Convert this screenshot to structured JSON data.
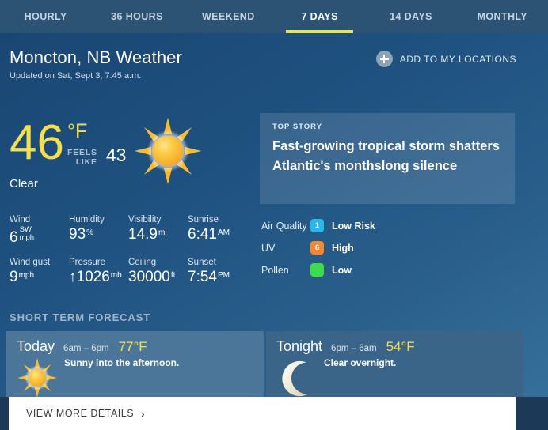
{
  "tabs": [
    {
      "label": "HOURLY",
      "active": false
    },
    {
      "label": "36 HOURS",
      "active": false
    },
    {
      "label": "WEEKEND",
      "active": false
    },
    {
      "label": "7 DAYS",
      "active": true
    },
    {
      "label": "14 DAYS",
      "active": false
    },
    {
      "label": "MONTHLY",
      "active": false
    }
  ],
  "header": {
    "title": "Moncton, NB Weather",
    "updated": "Updated on Sat, Sept 3, 7:45 a.m.",
    "add_location_label": "ADD TO MY LOCATIONS"
  },
  "current": {
    "temperature": "46",
    "unit": "°F",
    "feels_like_label_line1": "FEELS",
    "feels_like_label_line2": "LIKE",
    "feels_like_value": "43",
    "condition": "Clear",
    "icon": "sun-icon"
  },
  "top_story": {
    "kicker": "TOP STORY",
    "headline": "Fast-growing tropical storm shatters Atlantic's monthslong silence"
  },
  "stats": {
    "row1": [
      {
        "label": "Wind",
        "value": "6",
        "unit_top": "SW",
        "unit_bottom": "mph"
      },
      {
        "label": "Humidity",
        "value": "93",
        "unit_top": "%",
        "unit_bottom": ""
      },
      {
        "label": "Visibility",
        "value": "14.9",
        "unit_top": "mi",
        "unit_bottom": ""
      },
      {
        "label": "Sunrise",
        "value": "6:41",
        "unit_top": "AM",
        "unit_bottom": ""
      }
    ],
    "row2": [
      {
        "label": "Wind gust",
        "value": "9",
        "unit_top": "mph",
        "unit_bottom": ""
      },
      {
        "label": "Pressure",
        "value": "↑1026",
        "unit_top": "mb",
        "unit_bottom": ""
      },
      {
        "label": "Ceiling",
        "value": "30000",
        "unit_top": "ft",
        "unit_bottom": ""
      },
      {
        "label": "Sunset",
        "value": "7:54",
        "unit_top": "PM",
        "unit_bottom": ""
      }
    ]
  },
  "indices": [
    {
      "name": "Air Quality",
      "badge": "1",
      "badge_color": "#29b6e8",
      "description": "Low Risk"
    },
    {
      "name": "UV",
      "badge": "6",
      "badge_color": "#ef8a33",
      "description": "High"
    },
    {
      "name": "Pollen",
      "badge": "",
      "badge_color": "#3ddc4e",
      "description": "Low"
    }
  ],
  "short_term": {
    "section_title": "SHORT TERM FORECAST",
    "cards": [
      {
        "name": "Today",
        "range": "6am – 6pm",
        "temp": "77°F",
        "description": "Sunny into the afternoon.",
        "icon": "sun-icon"
      },
      {
        "name": "Tonight",
        "range": "6pm – 6am",
        "temp": "54°F",
        "description": "Clear overnight.",
        "icon": "moon-icon"
      }
    ]
  },
  "footer": {
    "view_more_label": "VIEW MORE DETAILS",
    "chevron": "›"
  }
}
